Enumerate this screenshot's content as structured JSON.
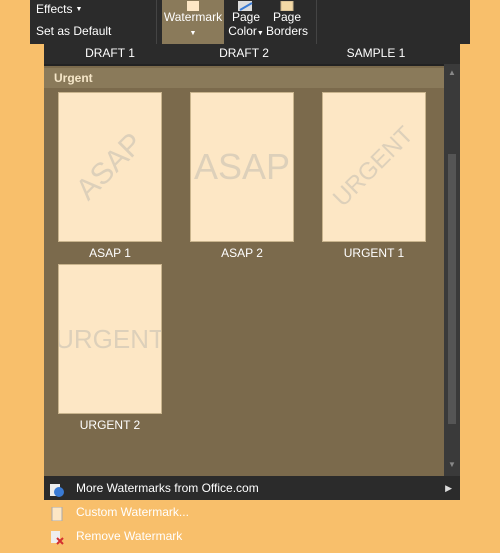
{
  "ribbon": {
    "effects_label": "Effects",
    "set_default_label": "Set as Default",
    "watermark_label": "Watermark",
    "page_color_line1": "Page",
    "page_color_line2": "Color",
    "page_borders_line1": "Page",
    "page_borders_line2": "Borders"
  },
  "gallery": {
    "previous_row": [
      "DRAFT 1",
      "DRAFT 2",
      "SAMPLE 1"
    ],
    "category": "Urgent",
    "items": [
      {
        "caption": "ASAP 1",
        "watermark": "ASAP",
        "style": "diagonal"
      },
      {
        "caption": "ASAP 2",
        "watermark": "ASAP",
        "style": "horizontal"
      },
      {
        "caption": "URGENT 1",
        "watermark": "URGENT",
        "style": "diagonal"
      },
      {
        "caption": "URGENT 2",
        "watermark": "URGENT",
        "style": "horizontal"
      }
    ]
  },
  "menu": {
    "more_watermarks": "More Watermarks from Office.com",
    "custom_watermark": "Custom Watermark...",
    "remove_watermark": "Remove Watermark"
  },
  "colors": {
    "background": "#f8bf6b",
    "dark": "#2b2b2b",
    "gallery_bg": "#7b6a4c",
    "page": "#fde7c5"
  }
}
